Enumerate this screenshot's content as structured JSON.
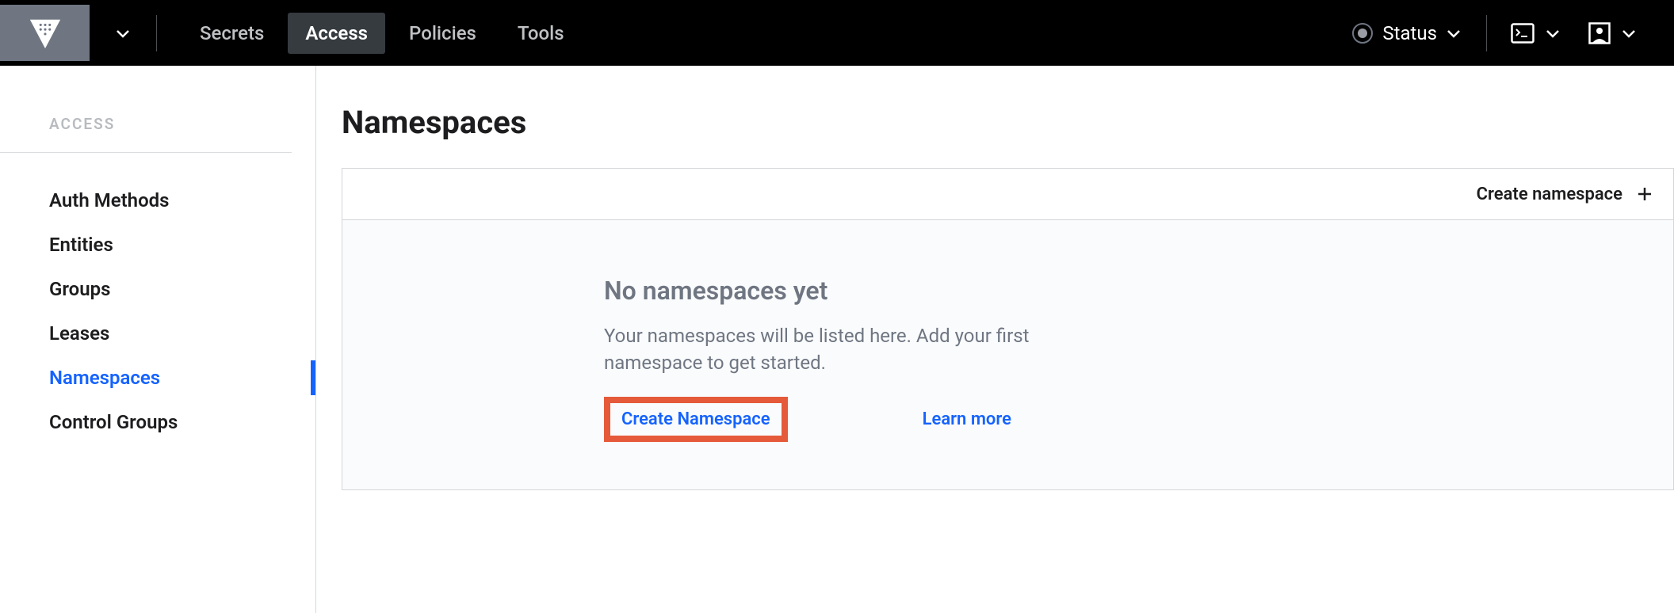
{
  "topnav": {
    "secrets": "Secrets",
    "access": "Access",
    "policies": "Policies",
    "tools": "Tools",
    "status": "Status"
  },
  "sidebar": {
    "heading": "ACCESS",
    "items": [
      {
        "label": "Auth Methods"
      },
      {
        "label": "Entities"
      },
      {
        "label": "Groups"
      },
      {
        "label": "Leases"
      },
      {
        "label": "Namespaces"
      },
      {
        "label": "Control Groups"
      }
    ]
  },
  "page": {
    "title": "Namespaces",
    "create_header": "Create namespace",
    "empty_title": "No namespaces yet",
    "empty_desc": "Your namespaces will be listed here. Add your first namespace to get started.",
    "create_action": "Create Namespace",
    "learn_more": "Learn more"
  }
}
